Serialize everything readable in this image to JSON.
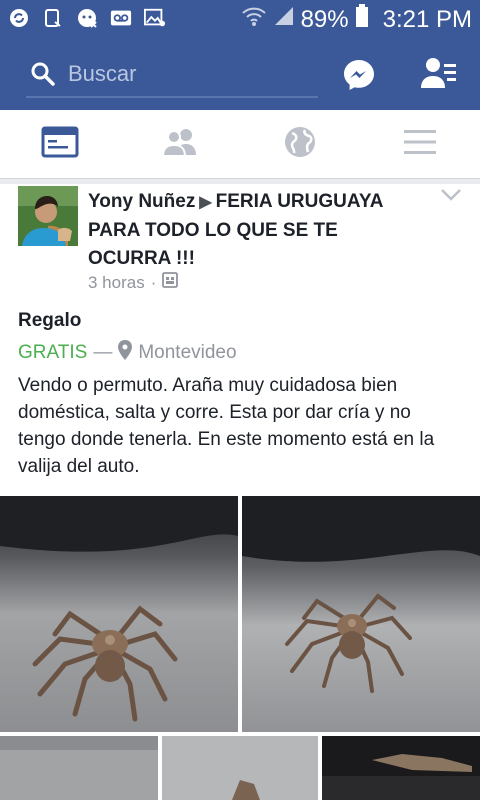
{
  "status_bar": {
    "battery": "89%",
    "time": "3:21 PM",
    "icons": [
      "sync-icon",
      "notification-icon",
      "cat-icon",
      "voicemail-icon",
      "image-icon",
      "wifi-icon",
      "signal-icon",
      "battery-icon"
    ]
  },
  "header": {
    "search_placeholder": "Buscar",
    "icons": [
      "search-icon",
      "messenger-icon",
      "friend-requests-icon"
    ]
  },
  "nav_tabs": [
    {
      "name": "news-feed",
      "icon": "news-feed-icon",
      "active": true
    },
    {
      "name": "friends",
      "icon": "friends-icon",
      "active": false
    },
    {
      "name": "notifications",
      "icon": "globe-icon",
      "active": false
    },
    {
      "name": "menu",
      "icon": "menu-icon",
      "active": false
    }
  ],
  "post": {
    "author": "Yony Nuñez",
    "group": "FERIA URUGUAYA PARA TODO LO QUE SE TE OCURRA !!!",
    "time": "3 horas",
    "dot": "·",
    "title": "Regalo",
    "price": "GRATIS",
    "dash": "—",
    "location": "Montevideo",
    "text": "Vendo o permuto. Araña muy cuidadosa bien doméstica, salta y corre. Esta por dar cría y no tengo donde tenerla. En este momento está en la valija del auto."
  },
  "colors": {
    "brand": "#3b5998",
    "price": "#4caf50",
    "meta": "#90949c"
  }
}
